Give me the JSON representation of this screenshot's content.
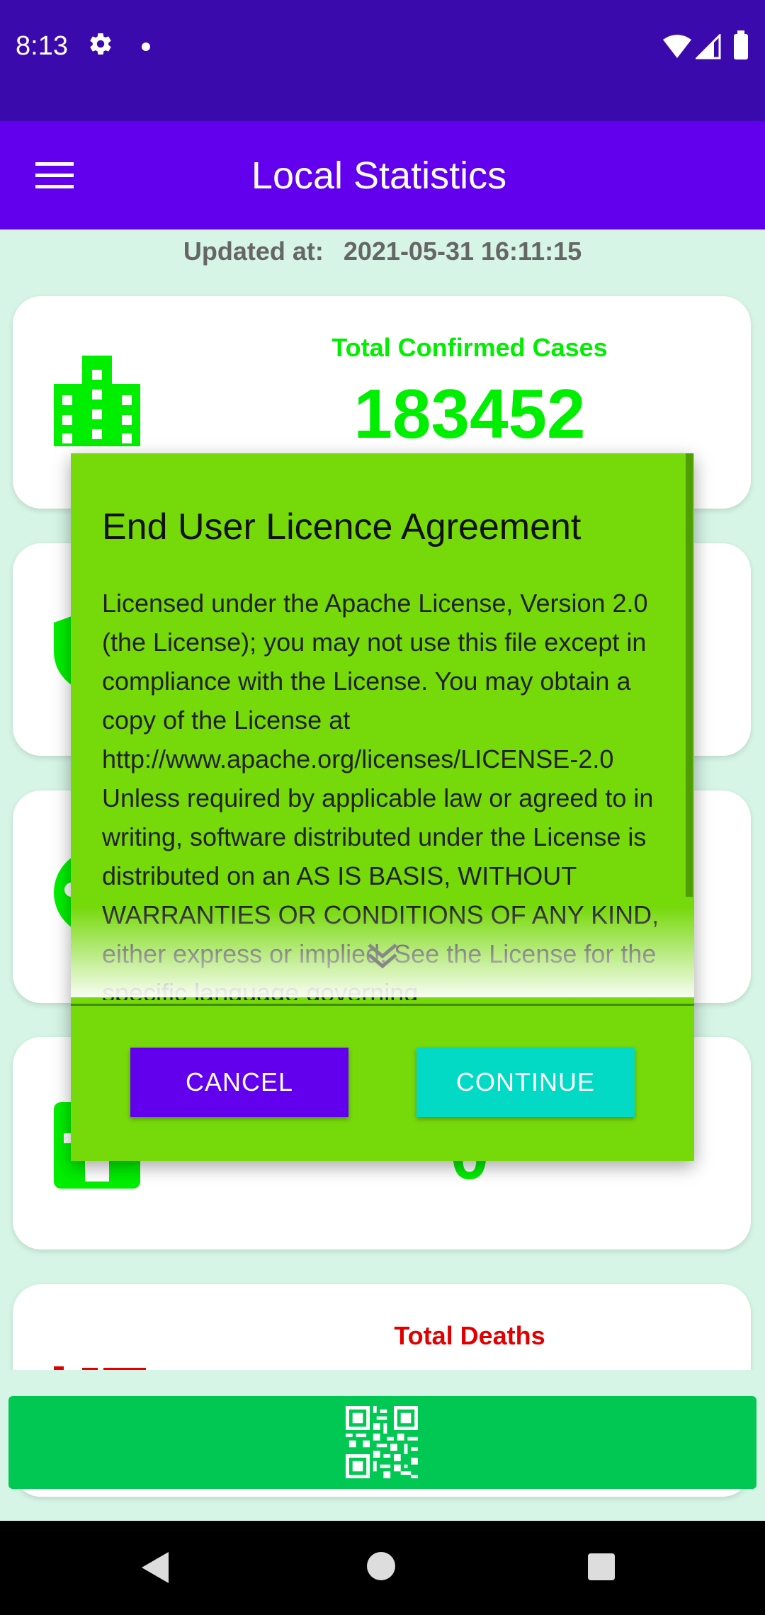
{
  "status_bar": {
    "time": "8:13"
  },
  "app_bar": {
    "title": "Local Statistics"
  },
  "updated": {
    "label": "Updated at:",
    "value": "2021-05-31 16:11:15"
  },
  "cards": [
    {
      "title": "Total Confirmed Cases",
      "value": "183452"
    },
    {
      "title": "",
      "value": ""
    },
    {
      "title": "",
      "value": ""
    },
    {
      "title": "",
      "value": "0"
    },
    {
      "title": "Total Deaths",
      "value": ""
    }
  ],
  "dialog": {
    "title": "End User Licence Agreement",
    "body": "Licensed under the Apache License, Version 2.0 (the License); you may not use this file except in compliance with the License. You may obtain a copy of the License at http://www.apache.org/licenses/LICENSE-2.0 Unless required by applicable law or agreed to in writing, software distributed under the License is distributed on an AS IS BASIS, WITHOUT WARRANTIES OR CONDITIONS OF ANY KIND, either express or implied. See the License for the specific language governing",
    "cancel_label": "CANCEL",
    "continue_label": "CONTINUE"
  },
  "colors": {
    "status_bar": "#3b0aad",
    "app_bar": "#6200ee",
    "background": "#d6f5e6",
    "stat_green": "#00ee00",
    "death_red": "#e00000",
    "dialog_bg": "#76d90a",
    "cancel_button": "#6200ee",
    "continue_button": "#03dac5",
    "qr_bar": "#00c853"
  },
  "icons": {
    "settings": "gear-icon",
    "menu": "hamburger-menu-icon",
    "card1": "building-icon",
    "qr": "qr-code-icon",
    "scroll_hint": "double-chevron-down-icon"
  }
}
